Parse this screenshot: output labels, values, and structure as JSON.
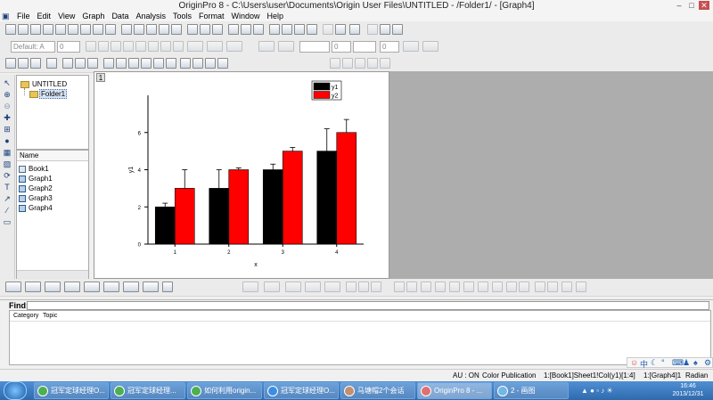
{
  "window": {
    "title": "OriginPro 8 - C:\\Users\\user\\Documents\\Origin User Files\\UNTITLED - /Folder1/ - [Graph4]"
  },
  "menu": [
    "File",
    "Edit",
    "View",
    "Graph",
    "Data",
    "Analysis",
    "Tools",
    "Format",
    "Window",
    "Help"
  ],
  "format_toolbar": {
    "font": "Default: A",
    "size": "0",
    "line_size": "0",
    "line_width": "0"
  },
  "explorer": {
    "root": "UNTITLED",
    "folder": "Folder1"
  },
  "filelist": {
    "header": "Name",
    "items": [
      "Book1",
      "Graph1",
      "Graph2",
      "Graph3",
      "Graph4"
    ]
  },
  "graph": {
    "layer_label": "1",
    "chart_data": {
      "type": "bar",
      "categories": [
        "1",
        "2",
        "3",
        "4"
      ],
      "series": [
        {
          "name": "y1",
          "color": "#000000",
          "values": [
            2,
            3,
            4,
            5
          ],
          "errors": [
            0.2,
            1.0,
            0.3,
            1.2
          ]
        },
        {
          "name": "y2",
          "color": "#ff0000",
          "values": [
            3,
            4,
            5,
            6
          ],
          "errors": [
            1.0,
            0.1,
            0.2,
            0.7
          ]
        }
      ],
      "xlabel": "x",
      "ylabel": "y1",
      "ylim": [
        0,
        8
      ],
      "yticks": [
        0,
        2,
        4,
        6
      ],
      "legend": "top-right"
    }
  },
  "find": {
    "label": "Find:",
    "columns": [
      "Category",
      "Topic"
    ]
  },
  "status": {
    "au": "AU : ON",
    "theme": "Color Publication",
    "sheet": "1:[Book1]Sheet1!Col(y1)[1:4]",
    "graph": "1:[Graph4]1",
    "unit": "Radian"
  },
  "taskbar": {
    "items": [
      "冠军定球经理O...",
      "冠军定球经理...",
      "如何利用origin...",
      "冠军定球经理O...",
      "马塘帽2个会话",
      "OriginPro 8 - ...",
      "2 - 画图"
    ],
    "time": "16:46",
    "date": "2013/12/31"
  }
}
